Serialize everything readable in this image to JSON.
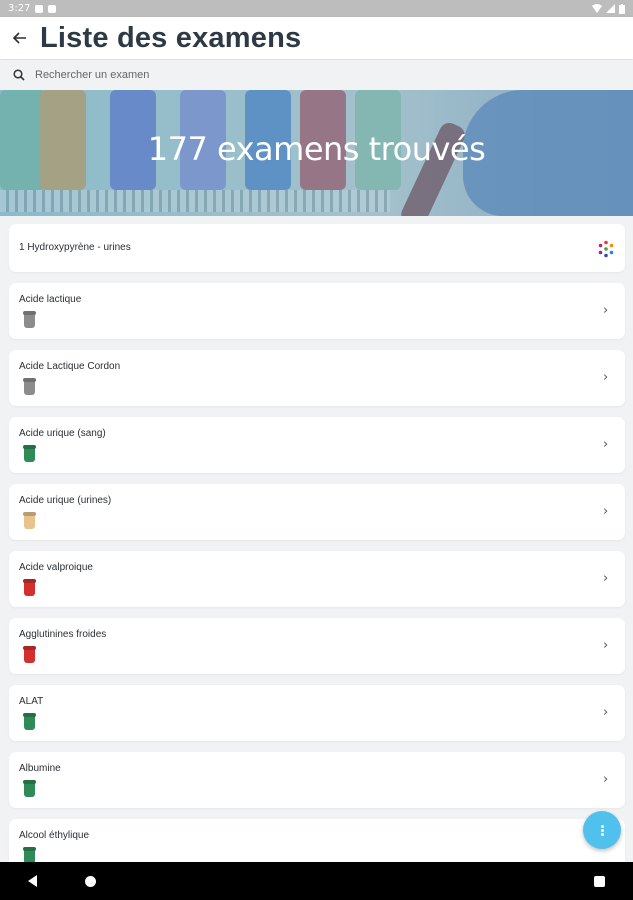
{
  "status_bar": {
    "time": "3:27"
  },
  "header": {
    "title": "Liste des examens"
  },
  "search": {
    "placeholder": "Rechercher un examen"
  },
  "banner": {
    "text": "177 examens trouvés"
  },
  "exams": [
    {
      "name": "1 Hydroxypyrène - urines",
      "tube_color": null,
      "icon": "multicolor-dots-icon"
    },
    {
      "name": "Acide lactique",
      "tube_color": "#8c8c8c"
    },
    {
      "name": "Acide Lactique Cordon",
      "tube_color": "#8c8c8c"
    },
    {
      "name": "Acide urique (sang)",
      "tube_color": "#2e8b57"
    },
    {
      "name": "Acide urique (urines)",
      "tube_color": "#e8c38e"
    },
    {
      "name": "Acide valproique",
      "tube_color": "#d32f2f"
    },
    {
      "name": "Agglutinines froides",
      "tube_color": "#d32f2f"
    },
    {
      "name": "ALAT",
      "tube_color": "#2e8b57"
    },
    {
      "name": "Albumine",
      "tube_color": "#2e8b57"
    },
    {
      "name": "Alcool éthylique",
      "tube_color": "#2e8b57"
    }
  ],
  "colors": {
    "accent": "#4fc1ec",
    "title": "#2d3a45"
  }
}
